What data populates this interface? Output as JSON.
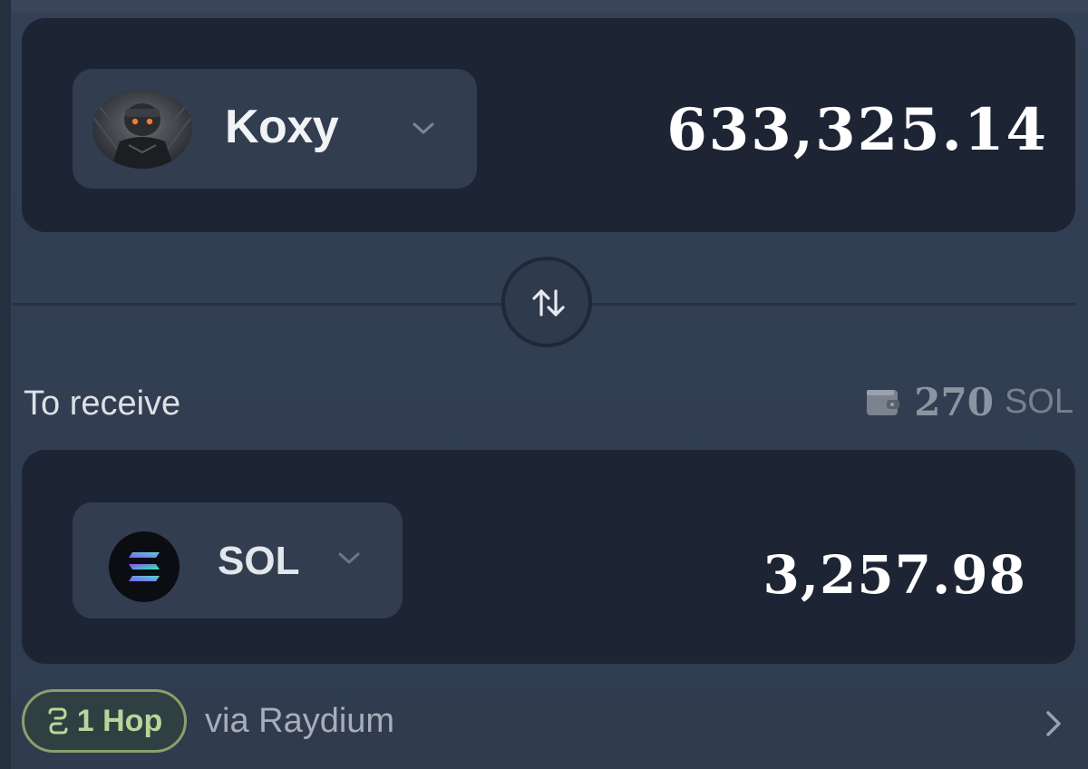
{
  "pay": {
    "token_name": "Koxy",
    "amount": "633,325.14",
    "avatar_icon": "warrior-avatar-icon"
  },
  "swap": {
    "icon": "swap-arrows-icon"
  },
  "receive": {
    "label": "To receive",
    "balance_value": "270",
    "balance_unit": "SOL",
    "token_name": "SOL",
    "amount": "3,257.98",
    "token_icon": "solana-logo-icon"
  },
  "route": {
    "hop_label": "1 Hop",
    "via_text": "via Raydium"
  },
  "colors": {
    "panel_background": "#2f3a4c",
    "card_background": "#1d2433",
    "hop_accent": "#b9d59a"
  }
}
